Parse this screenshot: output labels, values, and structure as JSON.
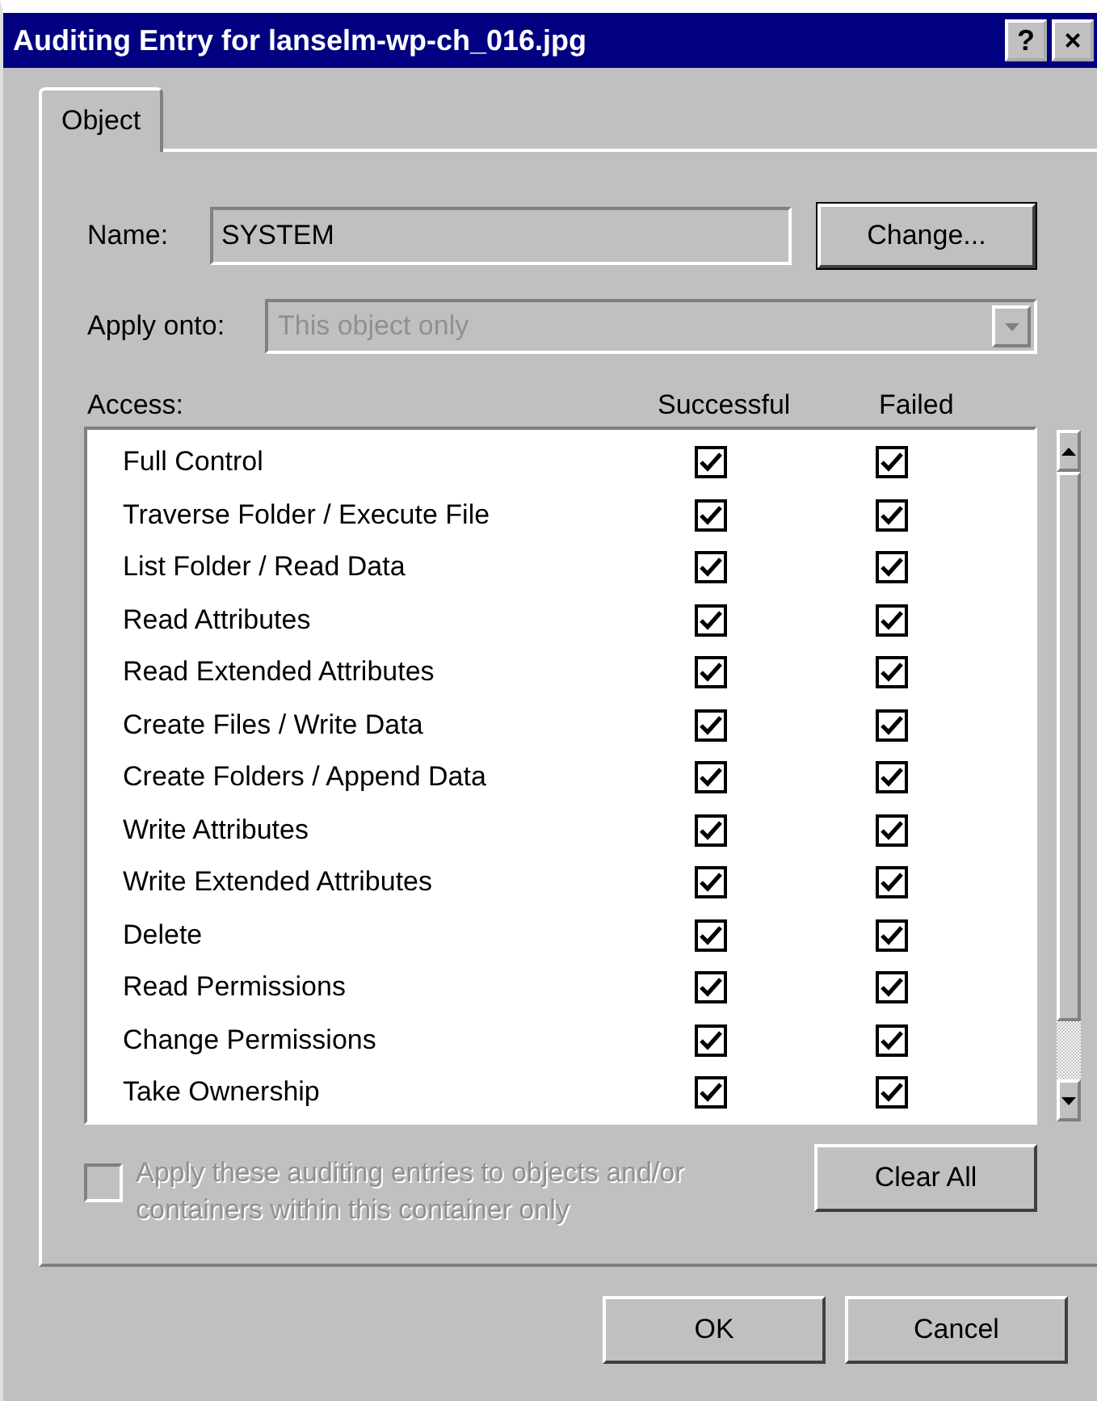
{
  "window": {
    "title": "Auditing Entry for lanselm-wp-ch_016.jpg",
    "help_button": "?",
    "close_button": "×"
  },
  "tabs": [
    {
      "label": "Object",
      "selected": true
    }
  ],
  "name_field": {
    "label": "Name:",
    "value": "SYSTEM"
  },
  "change_button": "Change...",
  "apply_onto": {
    "label": "Apply onto:",
    "value": "This object only",
    "disabled": true
  },
  "access": {
    "label": "Access:",
    "columns": [
      "Successful",
      "Failed"
    ],
    "rows": [
      {
        "name": "Full Control",
        "successful": true,
        "failed": true
      },
      {
        "name": "Traverse Folder / Execute File",
        "successful": true,
        "failed": true
      },
      {
        "name": "List Folder / Read Data",
        "successful": true,
        "failed": true
      },
      {
        "name": "Read Attributes",
        "successful": true,
        "failed": true
      },
      {
        "name": "Read Extended Attributes",
        "successful": true,
        "failed": true
      },
      {
        "name": "Create Files / Write Data",
        "successful": true,
        "failed": true
      },
      {
        "name": "Create Folders / Append Data",
        "successful": true,
        "failed": true
      },
      {
        "name": "Write Attributes",
        "successful": true,
        "failed": true
      },
      {
        "name": "Write Extended Attributes",
        "successful": true,
        "failed": true
      },
      {
        "name": "Delete",
        "successful": true,
        "failed": true
      },
      {
        "name": "Read Permissions",
        "successful": true,
        "failed": true
      },
      {
        "name": "Change Permissions",
        "successful": true,
        "failed": true
      },
      {
        "name": "Take Ownership",
        "successful": true,
        "failed": true
      }
    ]
  },
  "apply_checkbox": {
    "label": "Apply these auditing entries to objects and/or containers within this container only",
    "checked": false,
    "disabled": true
  },
  "clear_all_button": "Clear All",
  "buttons": [
    "OK",
    "Cancel"
  ]
}
